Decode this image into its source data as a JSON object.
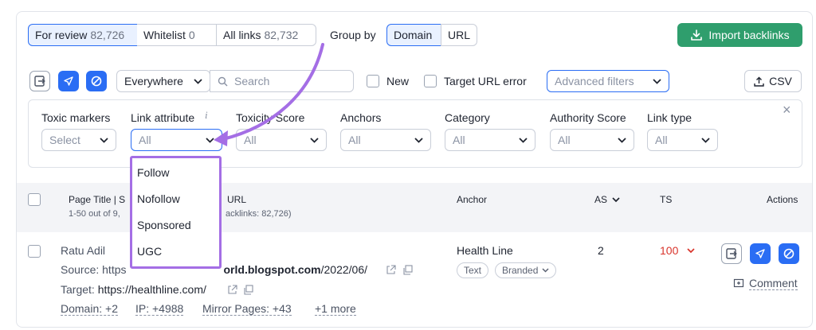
{
  "tabs": [
    {
      "label": "For review",
      "count": "82,726"
    },
    {
      "label": "Whitelist",
      "count": "0"
    },
    {
      "label": "All links",
      "count": "82,732"
    }
  ],
  "group_by": {
    "label": "Group by",
    "options": [
      "Domain",
      "URL"
    ],
    "selected": "Domain"
  },
  "import_button": "Import backlinks",
  "toolbar": {
    "scope_select": "Everywhere",
    "search_placeholder": "Search",
    "new_label": "New",
    "target_url_error_label": "Target URL error",
    "advanced_filters": "Advanced filters",
    "csv_label": "CSV"
  },
  "filters": [
    {
      "label": "Toxic markers",
      "value": "Select"
    },
    {
      "label": "Link attribute",
      "value": "All"
    },
    {
      "label": "Toxicity Score",
      "value": "All"
    },
    {
      "label": "Anchors",
      "value": "All"
    },
    {
      "label": "Category",
      "value": "All"
    },
    {
      "label": "Authority Score",
      "value": "All"
    },
    {
      "label": "Link type",
      "value": "All"
    }
  ],
  "link_attribute_info": "i",
  "close_symbol": "×",
  "dropdown_options": [
    "Follow",
    "Nofollow",
    "Sponsored",
    "UGC"
  ],
  "table_header": {
    "page_title": "Page Title | S",
    "url_part": "URL",
    "range_text": "1-50 out of 9,",
    "backlinks_text": "acklinks: 82,726)",
    "anchor": "Anchor",
    "as": "AS",
    "ts": "TS",
    "actions": "Actions"
  },
  "row": {
    "title": "Ratu Adil",
    "source_label": "Source:",
    "source_url_start": "https",
    "source_url_bold": "orld.blogspot.com",
    "source_url_path": "/2022/06/",
    "target_label": "Target:",
    "target_url": "https://healthline.com/",
    "domain": "Domain: +2",
    "ip": "IP: +4988",
    "mirror": "Mirror Pages: +43",
    "more": "+1 more",
    "anchor": "Health Line",
    "chip_text": "Text",
    "chip_branded": "Branded",
    "as_value": "2",
    "ts_value": "100",
    "comment": "Comment"
  },
  "colors": {
    "accent": "#2a6df4",
    "import_green": "#2f9e6d",
    "toxic_red": "#d9342b",
    "annotation_purple": "#a46ee5"
  }
}
